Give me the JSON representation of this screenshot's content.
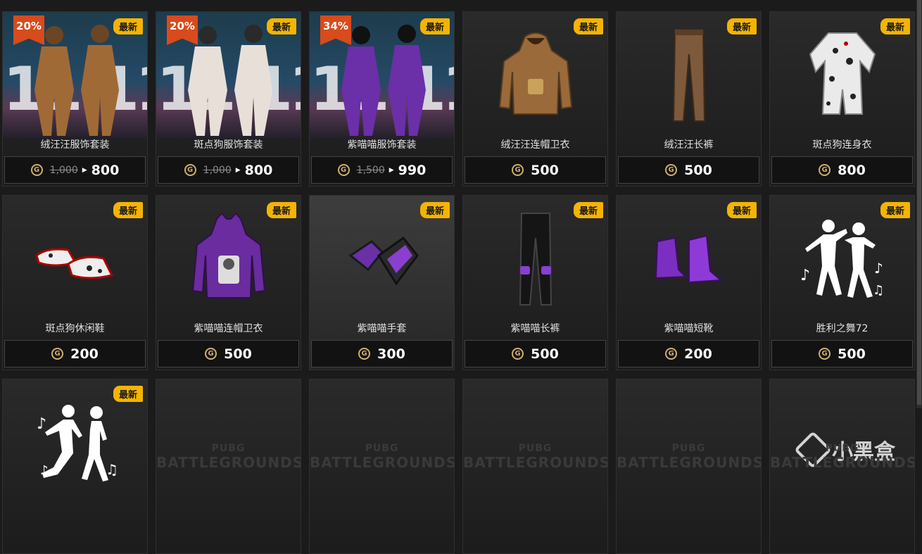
{
  "labels": {
    "new": "最新"
  },
  "currency": {
    "glyph": "G"
  },
  "items": [
    {
      "name": "绒汪汪服饰套装",
      "price": "800",
      "old_price": "1,000",
      "discount": "20%",
      "new": true,
      "bundle": true,
      "banner": "11.11"
    },
    {
      "name": "斑点狗服饰套装",
      "price": "800",
      "old_price": "1,000",
      "discount": "20%",
      "new": true,
      "bundle": true,
      "banner": "11.11"
    },
    {
      "name": "紫喵喵服饰套装",
      "price": "990",
      "old_price": "1,500",
      "discount": "34%",
      "new": true,
      "bundle": true,
      "banner": "11.11"
    },
    {
      "name": "绒汪汪连帽卫衣",
      "price": "500",
      "new": true,
      "art": "hoodie-brown"
    },
    {
      "name": "绒汪汪长裤",
      "price": "500",
      "new": true,
      "art": "pants-brown"
    },
    {
      "name": "斑点狗连身衣",
      "price": "800",
      "new": true,
      "art": "jumpsuit-dalmatian"
    },
    {
      "name": "斑点狗休闲鞋",
      "price": "200",
      "new": true,
      "art": "shoes-dalmatian"
    },
    {
      "name": "紫喵喵连帽卫衣",
      "price": "500",
      "new": true,
      "art": "hoodie-purple"
    },
    {
      "name": "紫喵喵手套",
      "price": "300",
      "new": true,
      "art": "gloves-purple",
      "highlight": true
    },
    {
      "name": "紫喵喵长裤",
      "price": "500",
      "new": true,
      "art": "pants-black"
    },
    {
      "name": "紫喵喵短靴",
      "price": "200",
      "new": true,
      "art": "boots-purple"
    },
    {
      "name": "胜利之舞72",
      "price": "500",
      "new": true,
      "art": "emote-dance"
    },
    {
      "name": "",
      "new": true,
      "art": "emote-dance2"
    }
  ],
  "placeholders": {
    "count": 5,
    "logo_top": "PUBG",
    "logo_bottom": "BATTLEGROUNDS"
  },
  "watermark": {
    "text": "小黑盒"
  }
}
